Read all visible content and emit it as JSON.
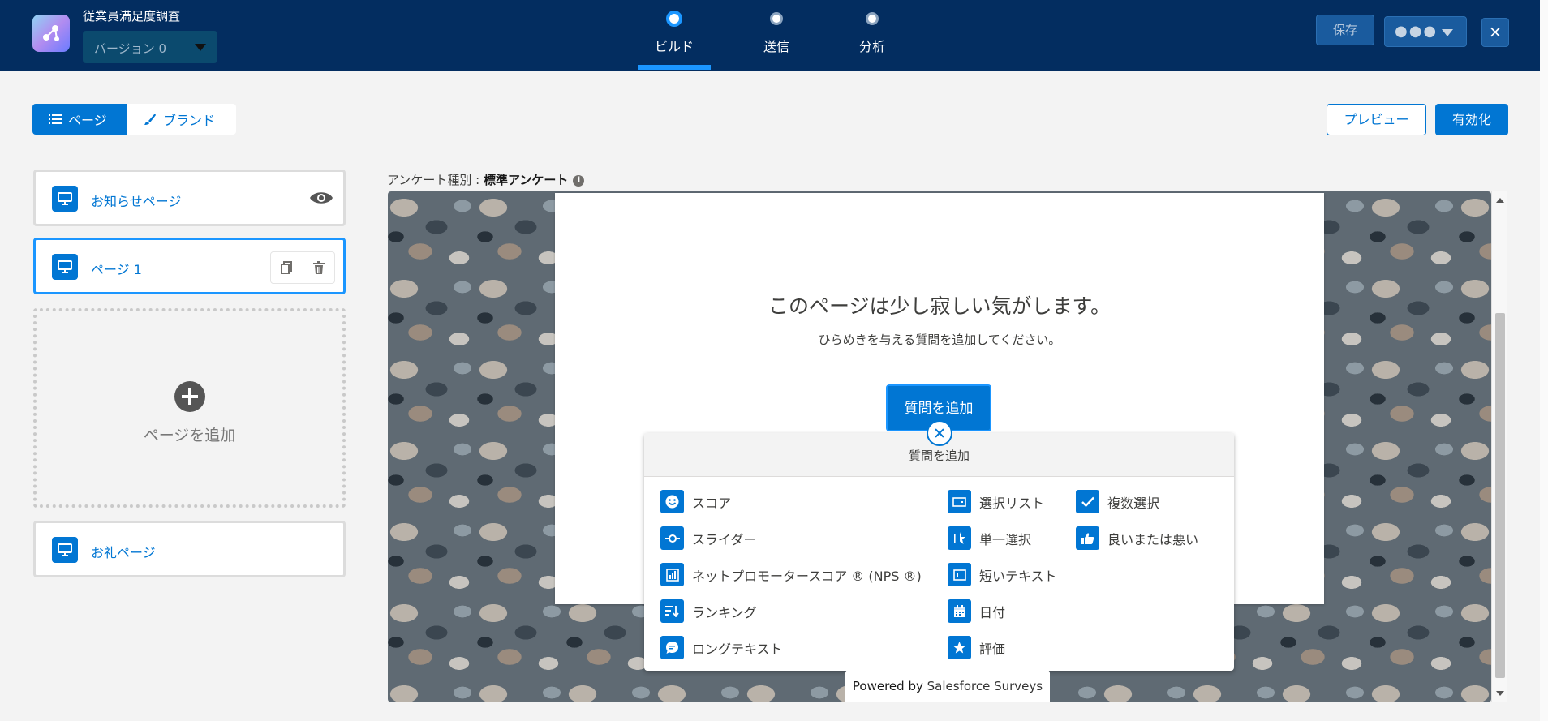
{
  "header": {
    "survey_title": "従業員満足度調査",
    "version": "バージョン 0",
    "steps": [
      {
        "label": "ビルド",
        "active": true
      },
      {
        "label": "送信",
        "active": false
      },
      {
        "label": "分析",
        "active": false
      }
    ],
    "save_label": "保存",
    "close_label": "×"
  },
  "toolbar": {
    "tab_pages": "ページ",
    "tab_brand": "ブランド",
    "preview": "プレビュー",
    "activate": "有効化"
  },
  "pages": {
    "welcome": "お知らせページ",
    "page1": "ページ 1",
    "add_page": "ページを追加",
    "thanks": "お礼ページ"
  },
  "canvas": {
    "survey_type_label": "アンケート種別 : ",
    "survey_type_value": "標準アンケート",
    "empty_title": "このページは少し寂しい気がします。",
    "empty_sub": "ひらめきを与える質問を追加してください。",
    "add_question": "質問を追加",
    "popover_title": "質問を追加",
    "powered_prefix": "Powered by ",
    "powered_brand": "Salesforce Surveys"
  },
  "question_types": {
    "score": "スコア",
    "slider": "スライダー",
    "nps": "ネットプロモータースコア ® (NPS ®)",
    "ranking": "ランキング",
    "long_text": "ロングテキスト",
    "picklist": "選択リスト",
    "single_choice": "単一選択",
    "short_text": "短いテキスト",
    "date": "日付",
    "rating": "評価",
    "multi_choice": "複数選択",
    "like_dislike": "良いまたは悪い"
  },
  "colors": {
    "header_bg": "#032d60",
    "brand_blue": "#0176d3",
    "accent_blue": "#1b96ff"
  }
}
